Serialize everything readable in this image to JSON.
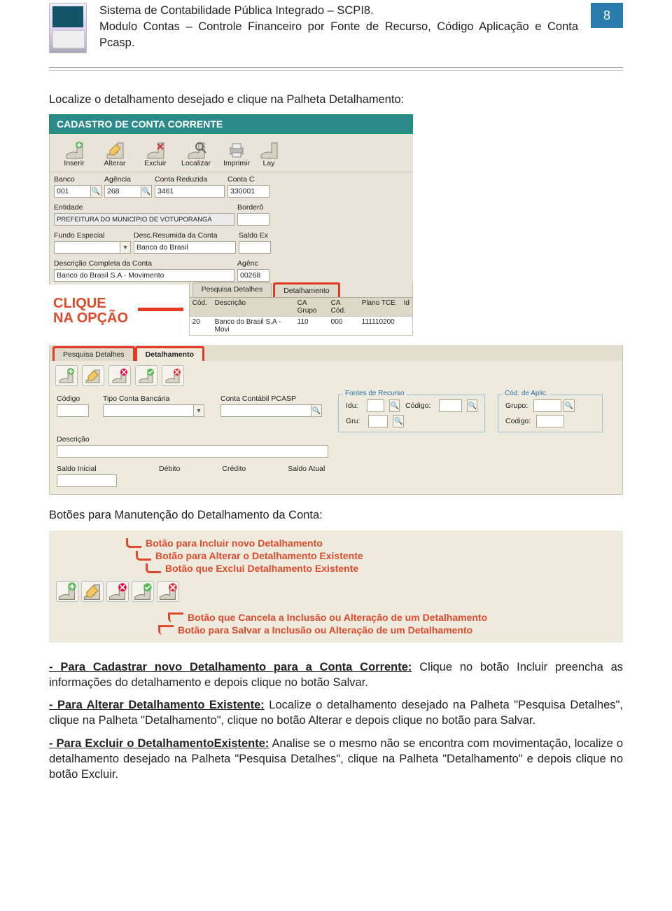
{
  "header": {
    "line1": "Sistema de Contabilidade Pública Integrado – SCPI8.",
    "line2": "Modulo Contas – Controle Financeiro por Fonte de Recurso, Código Aplicação e Conta Pcasp.",
    "page_num": "8"
  },
  "intro": {
    "line1": "Localize o detalhamento desejado e clique na Palheta Detalhamento:"
  },
  "shot1": {
    "title": "CADASTRO DE CONTA CORRENTE",
    "toolbar": [
      {
        "id": "inserir",
        "label": "Inserir"
      },
      {
        "id": "alterar",
        "label": "Alterar"
      },
      {
        "id": "excluir",
        "label": "Excluir"
      },
      {
        "id": "localizar",
        "label": "Localizar"
      },
      {
        "id": "imprimir",
        "label": "Imprimir"
      },
      {
        "id": "lay",
        "label": "Lay"
      }
    ],
    "fields": {
      "banco_label": "Banco",
      "banco_val": "001",
      "agencia_label": "Agência",
      "agencia_val": "268",
      "conta_red_label": "Conta Reduzida",
      "conta_red_val": "3461",
      "conta_c_label": "Conta C",
      "conta_c_val": "330001",
      "entidade_label": "Entidade",
      "entidade_val": "PREFEITURA DO MUNICÍPIO DE VOTUPORANGA",
      "bordero_label": "Borderô",
      "fundo_label": "Fundo Especial",
      "fundo_val": "",
      "desc_res_label": "Desc.Resumida da Conta",
      "desc_res_val": "Banco do Brasil",
      "saldo_label": "Saldo Ex",
      "desc_comp_label": "Descrição Completa da Conta",
      "desc_comp_val": "Banco do Brasil S.A - Movimento",
      "agenc2_label": "Agênc",
      "agenc2_val": "00268"
    },
    "callout": {
      "l1": "CLIQUE",
      "l2": "NA OPÇÃO"
    },
    "tabs": {
      "t1": "Pesquisa Detalhes",
      "t2": "Detalhamento"
    },
    "grid_h": {
      "c1": "Cód.",
      "c2": "Descrição",
      "c3": "CA Grupo",
      "c4": "CA Cód.",
      "c5": "Plano TCE",
      "c6": "Id"
    },
    "grid_r": {
      "c1": "20",
      "c2": "Banco do Brasil S.A - Movi",
      "c3": "110",
      "c4": "000",
      "c5": "111110200"
    }
  },
  "shot2": {
    "tab1": "Pesquisa Detalhes",
    "tab2": "Detalhamento",
    "codigo": "Código",
    "tipo": "Tipo Conta Bancária",
    "conta_pcasp": "Conta Contábil PCASP",
    "fontes_title": "Fontes de Recurso",
    "fontes_idu": "Idu:",
    "fontes_gru": "Gru:",
    "fontes_cod": "Código:",
    "aplic_title": "Cód. de Aplic.",
    "aplic_grp": "Grupo:",
    "aplic_cod": "Codigo:",
    "descricao": "Descrição",
    "saldo_ini": "Saldo Inicial",
    "debito": "Débito",
    "credito": "Crédito",
    "saldo_atual": "Saldo Atual"
  },
  "text_btns": "Botões para Manutenção do Detalhamento da Conta:",
  "shot3": {
    "d1": "Botão para Incluir novo Detalhamento",
    "d2": "Botão para Alterar o Detalhamento Existente",
    "d3": "Botão que Exclui Detalhamento Existente",
    "d4": "Botão que Cancela a Inclusão ou Alteração de um Detalhamento",
    "d5": "Botão para Salvar a Inclusão ou Alteração de um Detalhamento"
  },
  "body": {
    "p1_lead": "- Para Cadastrar novo Detalhamento para a Conta Corrente:",
    "p1_rest": " Clique no botão Incluir preencha as informações do detalhamento e depois clique no botão Salvar.",
    "p2_lead": "- Para Alterar Detalhamento Existente:",
    "p2_rest": " Localize o detalhamento desejado na Palheta \"Pesquisa Detalhes\", clique na Palheta \"Detalhamento\", clique no botão Alterar e depois clique no botão para Salvar.",
    "p3_lead": "- Para Excluir o DetalhamentoExistente:",
    "p3_rest": " Analise se o mesmo não se encontra com movimentação, localize o detalhamento desejado na Palheta \"Pesquisa Detalhes\", clique na Palheta \"Detalhamento\" e depois clique no botão Excluir."
  }
}
